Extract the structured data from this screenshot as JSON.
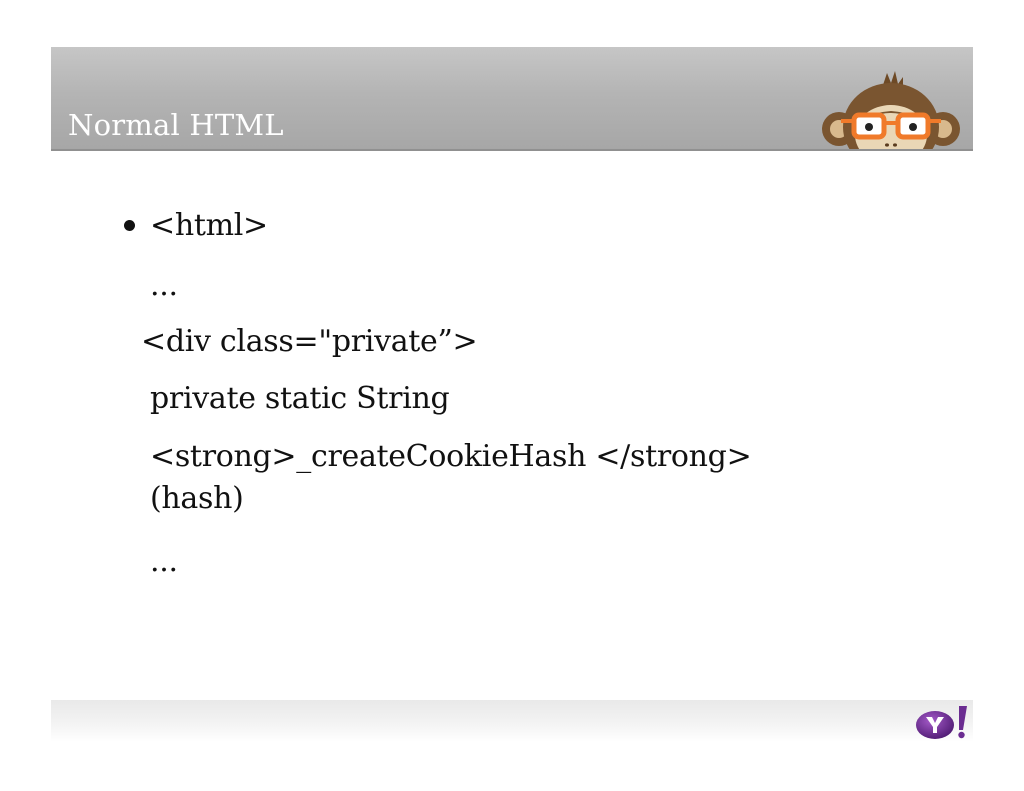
{
  "slide": {
    "title": "Normal HTML",
    "lines": [
      "<html>",
      "...",
      "<div class=\"private”>",
      "private static  String",
      "<strong>_createCookieHash </strong>",
      "(hash)",
      "..."
    ]
  },
  "colors": {
    "header": "#b0b0b0",
    "title_text": "#ffffff",
    "body_text": "#111111",
    "yahoo_purple": "#6b2c91"
  },
  "icons": {
    "mascot": "monkey-with-glasses-icon",
    "logo": "yahoo-logo-icon"
  }
}
